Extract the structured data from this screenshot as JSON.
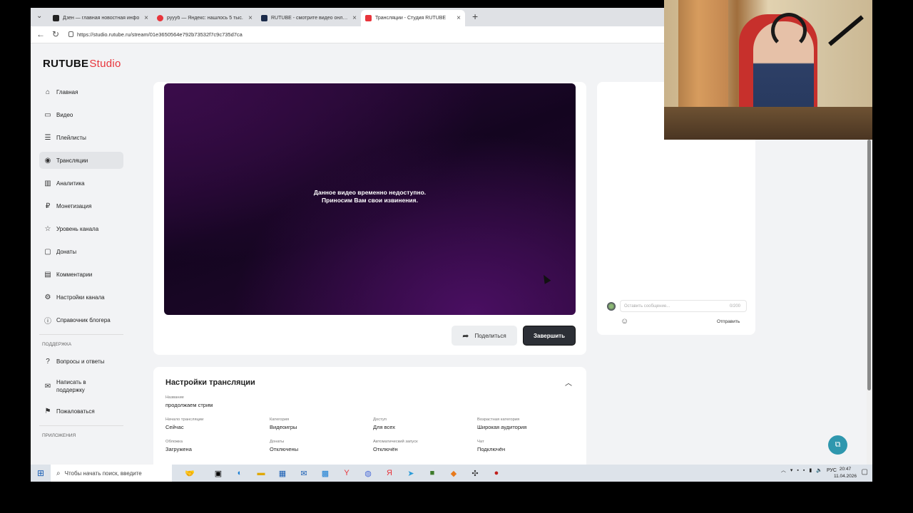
{
  "browser": {
    "tabs": [
      {
        "label": "Дзен — главная новостная инфо",
        "favicon_color": "#222222"
      },
      {
        "label": "руууб — Яндекс: нашлось 5 тыс.",
        "favicon_color": "#e8343b"
      },
      {
        "label": "RUTUBE - смотрите видео онлайн",
        "favicon_color": "#1b2b4a"
      },
      {
        "label": "Трансляции - Студия RUTUBE",
        "favicon_color": "#e8343b"
      }
    ],
    "url": "https://studio.rutube.ru/stream/01e3650564e792b73532f7c9c735d7ca"
  },
  "logo": {
    "brand": "RUTUBE",
    "product": "Studio"
  },
  "sidebar": {
    "items": [
      {
        "label": "Главная",
        "icon": "home-icon"
      },
      {
        "label": "Видео",
        "icon": "video-icon"
      },
      {
        "label": "Плейлисты",
        "icon": "playlist-icon"
      },
      {
        "label": "Трансляции",
        "icon": "broadcast-icon",
        "active": true
      },
      {
        "label": "Аналитика",
        "icon": "analytics-icon"
      },
      {
        "label": "Монетизация",
        "icon": "ruble-icon"
      },
      {
        "label": "Уровень канала",
        "icon": "star-icon"
      },
      {
        "label": "Донаты",
        "icon": "wallet-icon"
      },
      {
        "label": "Комментарии",
        "icon": "comment-icon"
      },
      {
        "label": "Настройки канала",
        "icon": "gear-icon"
      },
      {
        "label": "Справочник блогера",
        "icon": "info-icon"
      }
    ],
    "support_heading": "ПОДДЕРЖКА",
    "support_items": [
      {
        "label": "Вопросы и ответы",
        "icon": "question-icon"
      },
      {
        "label": "Написать в поддержку",
        "icon": "mail-icon"
      },
      {
        "label": "Пожаловаться",
        "icon": "flag-icon"
      }
    ],
    "apps_heading": "ПРИЛОЖЕНИЯ"
  },
  "player": {
    "message_line1": "Данное видео временно недоступно.",
    "message_line2": "Приносим Вам свои извинения."
  },
  "actions": {
    "share_label": "Поделиться",
    "finish_label": "Завершить"
  },
  "chat": {
    "placeholder": "Оставить сообщение...",
    "counter": "0/200",
    "send_label": "Отправить"
  },
  "settings": {
    "title": "Настройки трансляции",
    "name_label": "Название",
    "name_value": "продолжаем стрим",
    "fields": [
      {
        "label": "Начало трансляции",
        "value": "Сейчас"
      },
      {
        "label": "Категория",
        "value": "Видеоигры"
      },
      {
        "label": "Доступ",
        "value": "Для всех"
      },
      {
        "label": "Возрастная категория",
        "value": "Широкая аудитория"
      },
      {
        "label": "Обложка",
        "value": "Загружена"
      },
      {
        "label": "Донаты",
        "value": "Отключены"
      },
      {
        "label": "Автоматический запуск",
        "value": "Отключён"
      },
      {
        "label": "Чат",
        "value": "Подключён"
      }
    ]
  },
  "taskbar": {
    "search_placeholder": "Чтобы начать поиск, введите",
    "language": "РУС",
    "time": "20:47",
    "date": "11.04.2026"
  },
  "colors": {
    "accent": "#e8343b",
    "finish_button": "#2c2f36",
    "fab": "#2f97ae"
  }
}
